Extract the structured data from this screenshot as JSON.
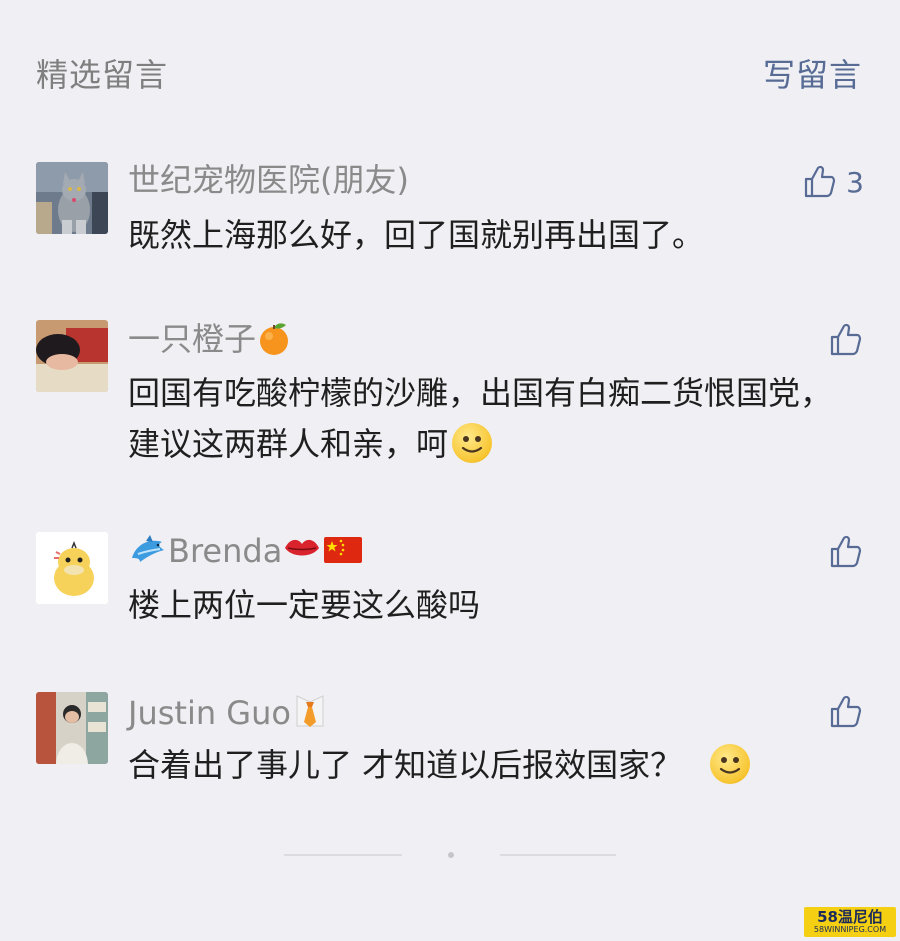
{
  "header": {
    "title": "精选留言",
    "write_label": "写留言"
  },
  "comments": [
    {
      "nickname": "世纪宠物医院(朋友)",
      "text": "既然上海那么好，回了国就别再出国了。",
      "likes": "3"
    },
    {
      "nickname": "一只橙子",
      "text": "回国有吃酸柠檬的沙雕，出国有白痴二货恨国党，建议这两群人和亲，呵",
      "likes": ""
    },
    {
      "nickname": "Brenda",
      "text": "楼上两位一定要这么酸吗",
      "likes": ""
    },
    {
      "nickname": "Justin Guo",
      "text": "合着出了事儿了 才知道以后报效国家？",
      "likes": ""
    }
  ],
  "watermark": {
    "top": "58温尼伯",
    "bottom": "58WINNIPEG.COM"
  },
  "colors": {
    "background": "#efeff4",
    "link": "#576b95",
    "nickname": "#8a8a8a",
    "text": "#1f1f1f"
  },
  "icons": {
    "like": "thumbs-up-outline-icon",
    "orange": "tangerine-emoji",
    "dolphin": "dolphin-emoji",
    "lips": "kiss-mark-emoji",
    "flag": "china-flag-emoji",
    "tie": "necktie-emoji",
    "smile": "smiley-face-emoji"
  }
}
